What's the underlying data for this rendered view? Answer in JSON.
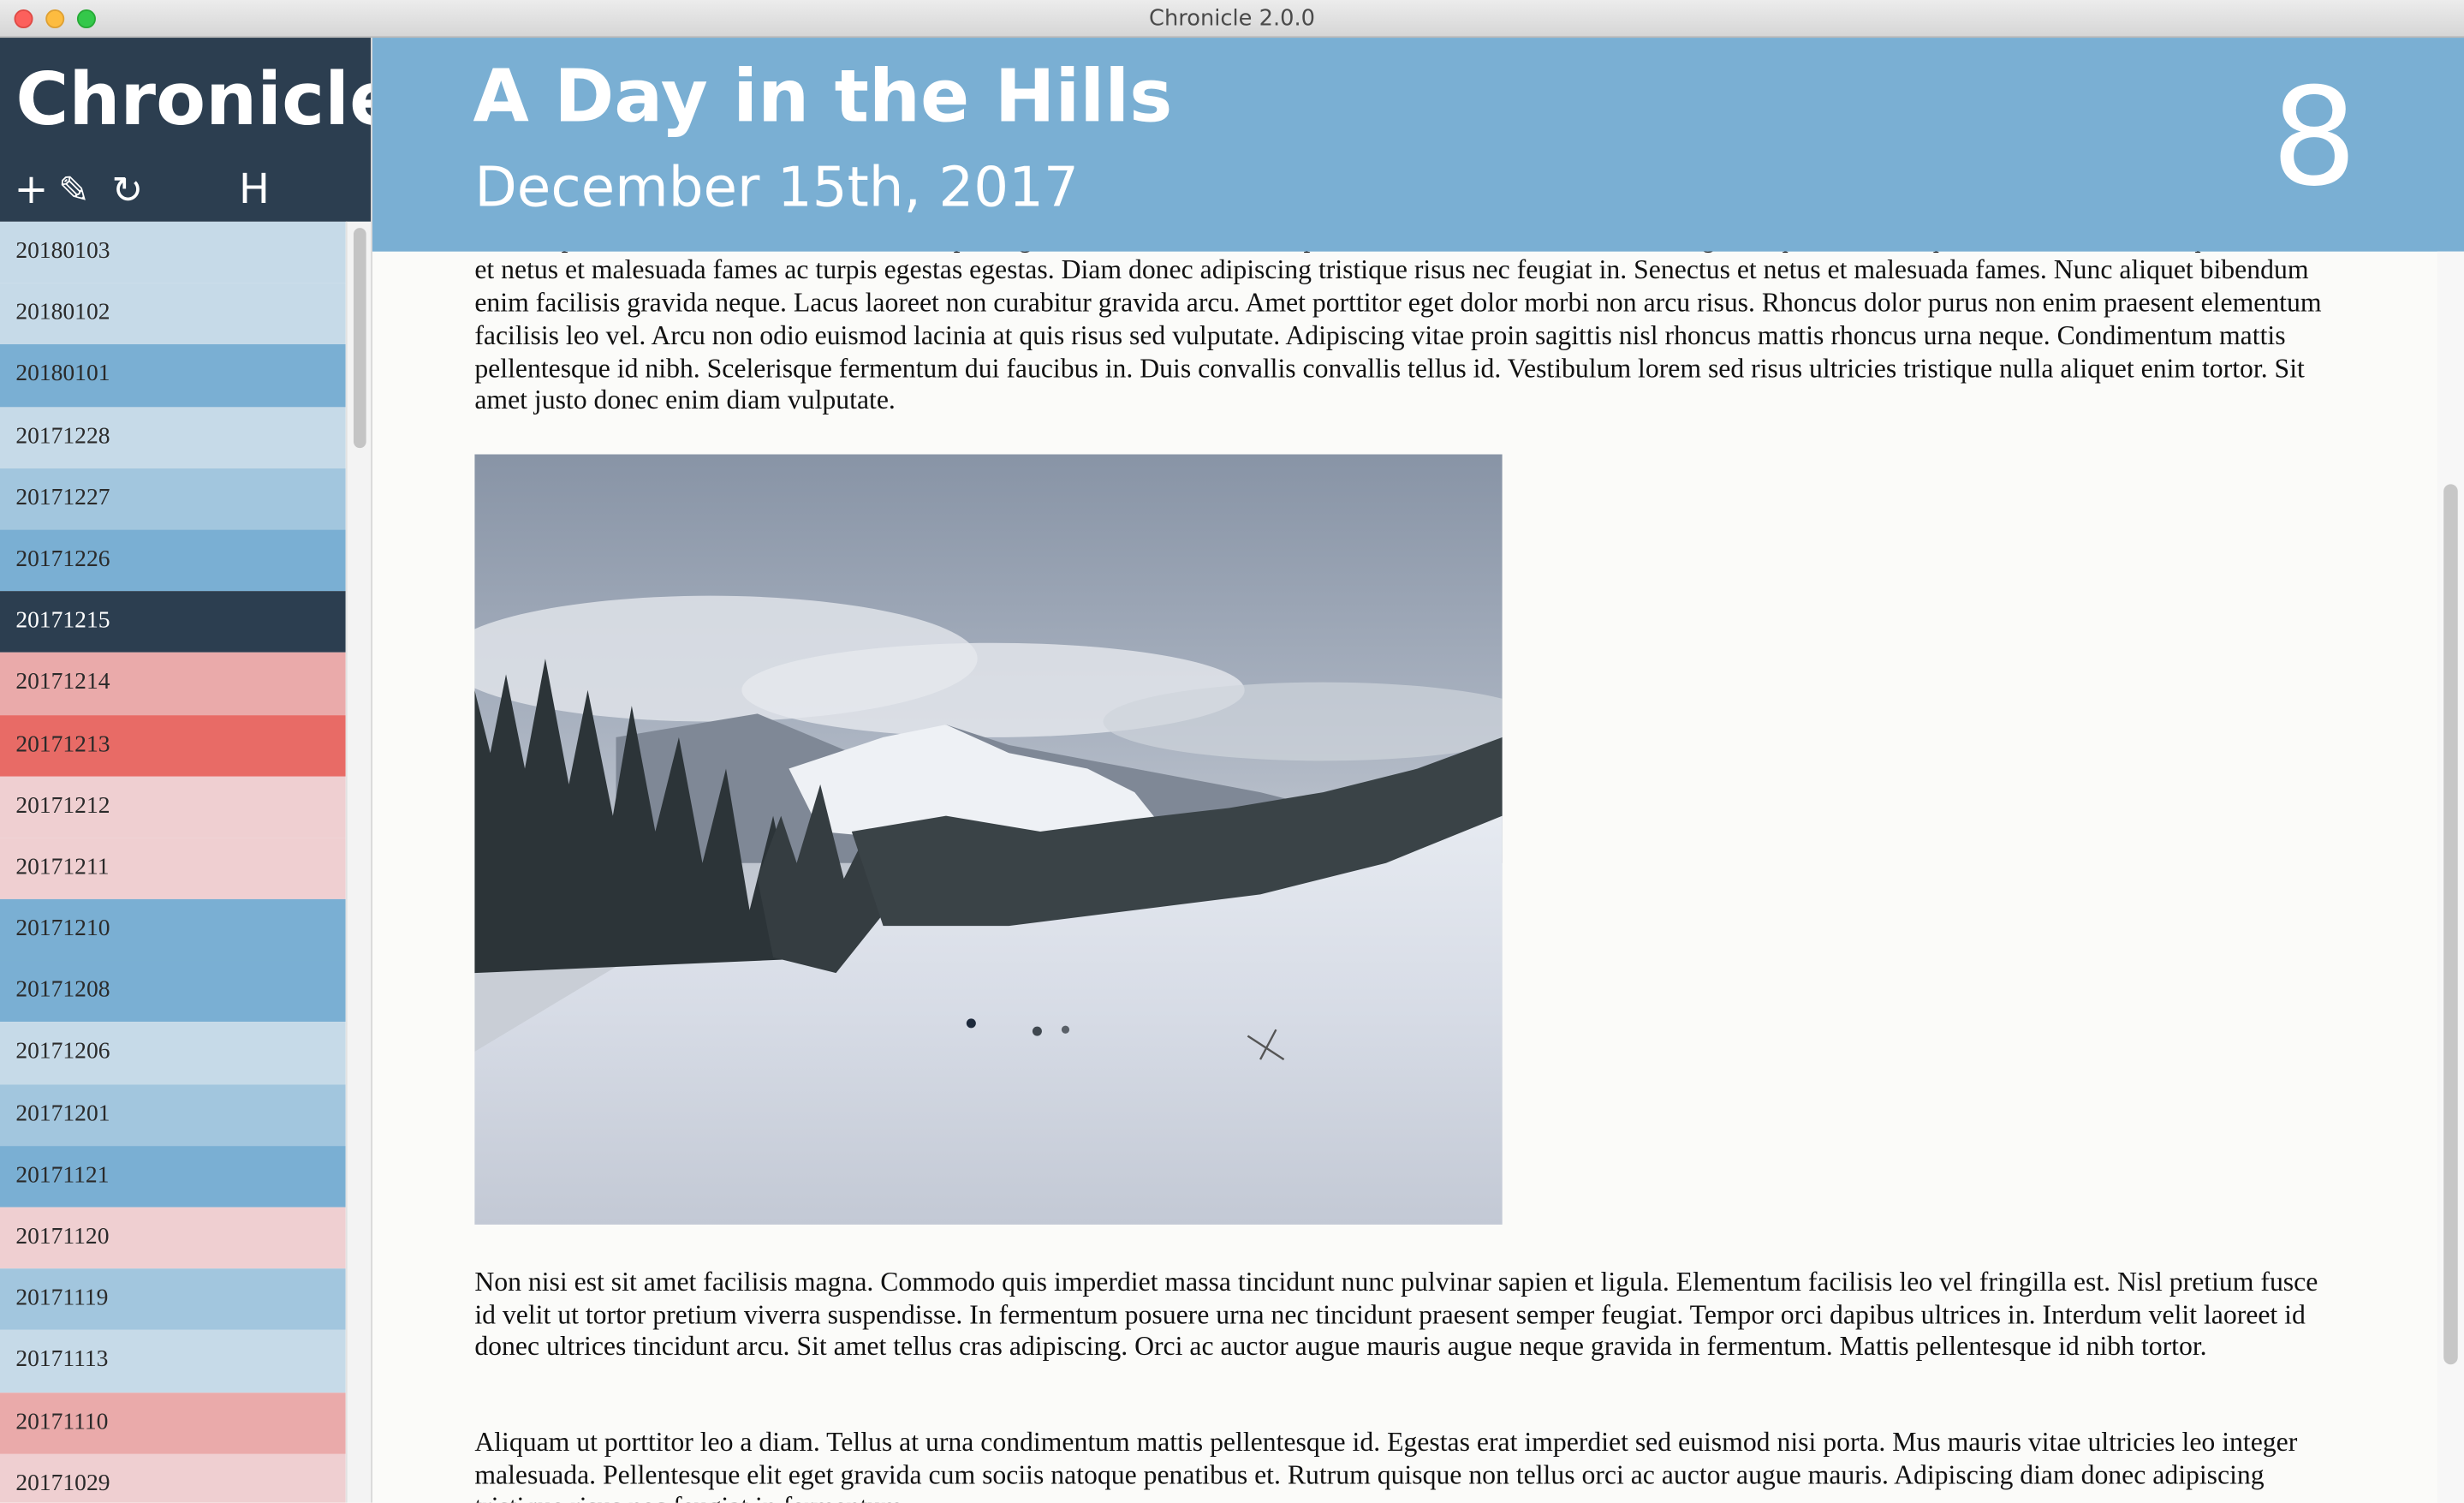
{
  "window": {
    "title": "Chronicle 2.0.0"
  },
  "sidebar": {
    "app_name": "Chronicle",
    "tools": {
      "add": "+",
      "edit": "✎",
      "refresh": "↻",
      "h": "H"
    },
    "entries": [
      {
        "label": "20180103",
        "color": "#c6dae8"
      },
      {
        "label": "20180102",
        "color": "#c6dae8"
      },
      {
        "label": "20180101",
        "color": "#7aafd3"
      },
      {
        "label": "20171228",
        "color": "#c6dae8"
      },
      {
        "label": "20171227",
        "color": "#a2c6de"
      },
      {
        "label": "20171226",
        "color": "#7aafd3"
      },
      {
        "label": "20171215",
        "color": "#2c3e50",
        "selected": true
      },
      {
        "label": "20171214",
        "color": "#eaaaaa"
      },
      {
        "label": "20171213",
        "color": "#e86b66"
      },
      {
        "label": "20171212",
        "color": "#efcfd1"
      },
      {
        "label": "20171211",
        "color": "#efcfd1"
      },
      {
        "label": "20171210",
        "color": "#7aafd3"
      },
      {
        "label": "20171208",
        "color": "#7aafd3"
      },
      {
        "label": "20171206",
        "color": "#c6dae8"
      },
      {
        "label": "20171201",
        "color": "#a2c6de"
      },
      {
        "label": "20171121",
        "color": "#7aafd3"
      },
      {
        "label": "20171120",
        "color": "#efcfd1"
      },
      {
        "label": "20171119",
        "color": "#a2c6de"
      },
      {
        "label": "20171113",
        "color": "#c6dae8"
      },
      {
        "label": "20171110",
        "color": "#eaaaaa"
      },
      {
        "label": "20171029",
        "color": "#efcfd1"
      }
    ]
  },
  "entry": {
    "title": "A Day in the Hills",
    "date": "December 15th, 2017",
    "count": "8",
    "paragraph_1": "Lorem ipsum dolor sit amet, consectetur adipiscing elit, sed do eiusmod tempor incididunt ut labore et dolore magna aliqua. Pellentesque habitant morbi tristique senectus et netus et malesuada fames ac turpis egestas egestas. Diam donec adipiscing tristique risus nec feugiat in. Senectus et netus et malesuada fames. Nunc aliquet bibendum enim facilisis gravida neque. Lacus laoreet non curabitur gravida arcu. Amet porttitor eget dolor morbi non arcu risus. Rhoncus dolor purus non enim praesent elementum facilisis leo vel. Arcu non odio euismod lacinia at quis risus sed vulputate. Adipiscing vitae proin sagittis nisl rhoncus mattis rhoncus urna neque. Condimentum mattis pellentesque id nibh. Scelerisque fermentum dui faucibus in. Duis convallis convallis tellus id. Vestibulum lorem sed risus ultricies tristique nulla aliquet enim tortor. Sit amet justo donec enim diam vulputate.",
    "paragraph_2": "Non nisi est sit amet facilisis magna. Commodo quis imperdiet massa tincidunt nunc pulvinar sapien et ligula. Elementum facilisis leo vel fringilla est. Nisl pretium fusce id velit ut tortor pretium viverra suspendisse. In fermentum posuere urna nec tincidunt praesent semper feugiat. Tempor orci dapibus ultrices in. Interdum velit laoreet id donec ultrices tincidunt arcu. Sit amet tellus cras adipiscing. Orci ac auctor augue mauris augue neque gravida in fermentum. Mattis pellentesque id nibh tortor.",
    "paragraph_3": "Aliquam ut porttitor leo a diam. Tellus at urna condimentum mattis pellentesque id. Egestas erat imperdiet sed euismod nisi porta. Mus mauris vitae ultricies leo integer malesuada. Pellentesque elit eget gravida cum sociis natoque penatibus et. Rutrum quisque non tellus orci ac auctor augue mauris. Adipiscing diam donec adipiscing tristique risus nec feugiat in fermentum."
  },
  "colors": {
    "header_blue": "#7aafd3",
    "sidebar_dark": "#2c3e50",
    "selected_row": "#2c3e50"
  }
}
